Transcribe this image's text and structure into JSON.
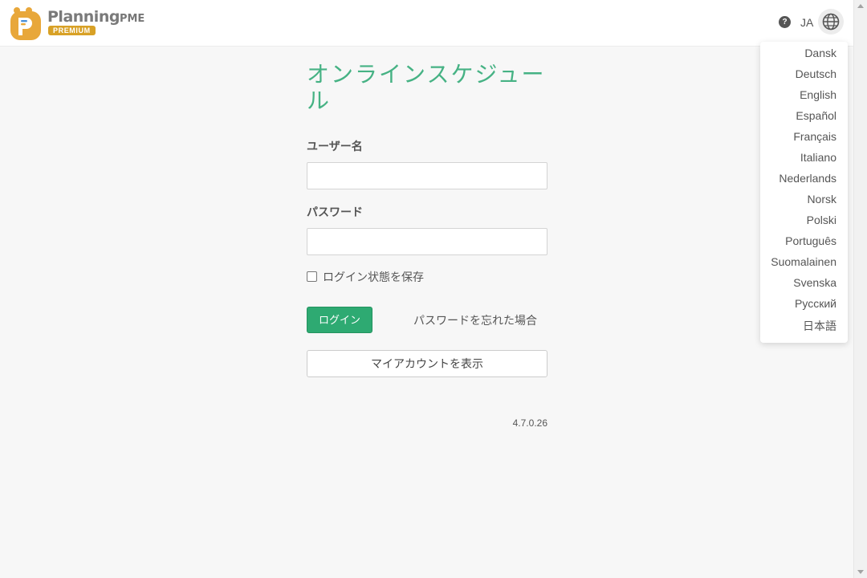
{
  "header": {
    "logo_text": "Planning",
    "logo_text_suffix": "PME",
    "logo_badge": "PREMIUM",
    "help_icon": "?",
    "current_language": "JA",
    "globe_icon": "globe-icon"
  },
  "language_menu": {
    "items": [
      "Dansk",
      "Deutsch",
      "English",
      "Español",
      "Français",
      "Italiano",
      "Nederlands",
      "Norsk",
      "Polski",
      "Português",
      "Suomalainen",
      "Svenska",
      "Русский",
      "日本語"
    ]
  },
  "login": {
    "title": "オンラインスケジュール",
    "username_label": "ユーザー名",
    "username_value": "",
    "password_label": "パスワード",
    "password_value": "",
    "remember_label": "ログイン状態を保存",
    "remember_checked": false,
    "login_button": "ログイン",
    "forgot_link": "パスワードを忘れた場合",
    "account_button": "マイアカウントを表示",
    "version": "4.7.0.26"
  },
  "colors": {
    "accent_green": "#2eaa72",
    "title_green": "#46b284",
    "badge_gold": "#d8a126",
    "logo_orange": "#e8a73a"
  }
}
